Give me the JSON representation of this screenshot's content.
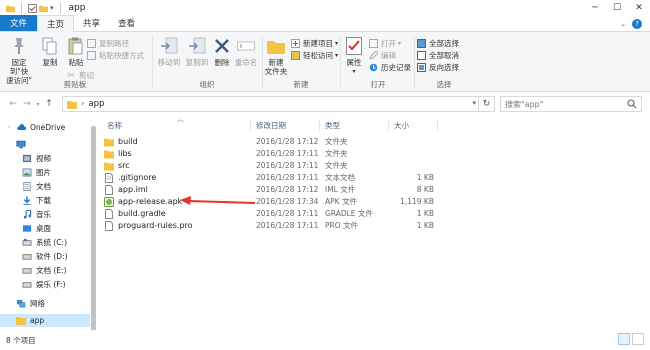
{
  "window": {
    "title": "app",
    "controls": [
      "minimize-icon",
      "maximize-icon",
      "close-icon"
    ]
  },
  "ribbon_tabs": [
    {
      "label": "文件"
    },
    {
      "label": "主页"
    },
    {
      "label": "共享"
    },
    {
      "label": "查看"
    }
  ],
  "ribbon": {
    "pin_label_1": "固定到\"快",
    "pin_label_2": "速访问\"",
    "copy_label": "复制",
    "paste_label": "粘贴",
    "copy_path_label": "复制路径",
    "paste_shortcut_label": "粘贴快捷方式",
    "cut_label": "剪切",
    "clipboard_group": "剪贴板",
    "move_to_label": "移动到",
    "copy_to_label": "复制到",
    "delete_label": "删除",
    "rename_label": "重命名",
    "organize_group": "组织",
    "new_folder_label_1": "新建",
    "new_folder_label_2": "文件夹",
    "new_item_label": "新建项目",
    "easy_access_label": "轻松访问",
    "new_group": "新建",
    "properties_label": "属性",
    "open_label": "打开",
    "edit_label": "编辑",
    "history_label": "历史记录",
    "open_group": "打开",
    "select_all_label": "全部选择",
    "select_none_label": "全部取消",
    "invert_selection_label": "反向选择",
    "select_group": "选择"
  },
  "address": {
    "path": "app",
    "search_placeholder": "搜索\"app\""
  },
  "navpane": {
    "items": [
      {
        "label": "OneDrive",
        "icon": "cloud-icon"
      },
      {
        "label": "",
        "icon": "computer-icon"
      },
      {
        "label": "视频",
        "icon": "video-icon"
      },
      {
        "label": "图片",
        "icon": "pictures-icon"
      },
      {
        "label": "文档",
        "icon": "documents-icon"
      },
      {
        "label": "下载",
        "icon": "download-icon"
      },
      {
        "label": "音乐",
        "icon": "music-icon"
      },
      {
        "label": "桌面",
        "icon": "desktop-icon"
      },
      {
        "label": "系统 (C:)",
        "icon": "drive-icon"
      },
      {
        "label": "软件 (D:)",
        "icon": "drive-icon"
      },
      {
        "label": "文档 (E:)",
        "icon": "drive-icon"
      },
      {
        "label": "娱乐 (F:)",
        "icon": "drive-icon"
      },
      {
        "label": "网络",
        "icon": "network-icon"
      },
      {
        "label": "app",
        "icon": "folder-icon"
      }
    ]
  },
  "filelist": {
    "headers": {
      "name": "名称",
      "date": "修改日期",
      "type": "类型",
      "size": "大小"
    },
    "rows": [
      {
        "name": "build",
        "date": "2016/1/28 17:12",
        "type": "文件夹",
        "size": "",
        "icon": "folder-icon"
      },
      {
        "name": "libs",
        "date": "2016/1/28 17:11",
        "type": "文件夹",
        "size": "",
        "icon": "folder-icon"
      },
      {
        "name": "src",
        "date": "2016/1/28 17:11",
        "type": "文件夹",
        "size": "",
        "icon": "folder-icon"
      },
      {
        "name": ".gitignore",
        "date": "2016/1/28 17:11",
        "type": "文本文档",
        "size": "1 KB",
        "icon": "text-file-icon"
      },
      {
        "name": "app.iml",
        "date": "2016/1/28 17:12",
        "type": "IML 文件",
        "size": "8 KB",
        "icon": "file-icon"
      },
      {
        "name": "app-release.apk",
        "date": "2016/1/28 17:34",
        "type": "APK 文件",
        "size": "1,119 KB",
        "icon": "apk-icon"
      },
      {
        "name": "build.gradle",
        "date": "2016/1/28 17:11",
        "type": "GRADLE 文件",
        "size": "1 KB",
        "icon": "file-icon"
      },
      {
        "name": "proguard-rules.pro",
        "date": "2016/1/28 17:11",
        "type": "PRO 文件",
        "size": "1 KB",
        "icon": "file-icon"
      }
    ]
  },
  "status": {
    "count": "8 个项目"
  },
  "colors": {
    "accent": "#1979ca",
    "arrow": "#e8312b",
    "folder": "#f5c342",
    "selection": "#cce8ff"
  }
}
